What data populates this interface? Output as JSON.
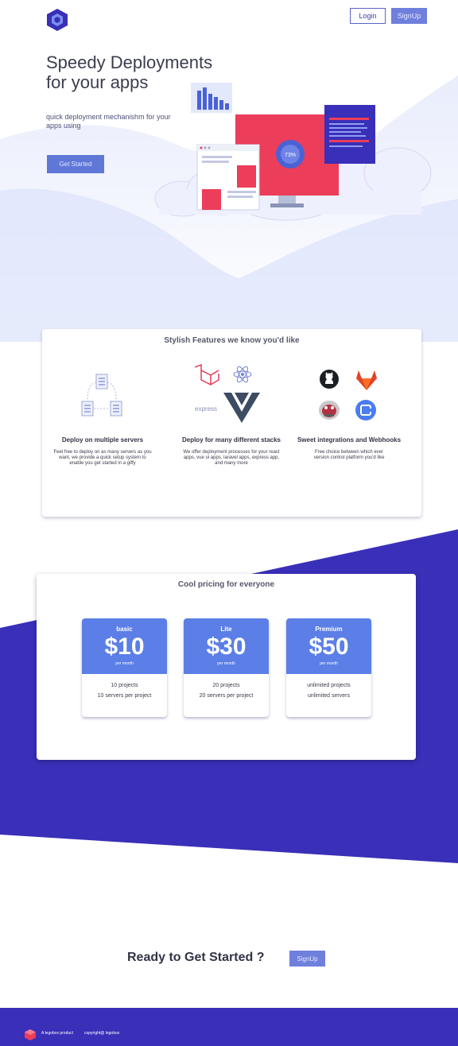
{
  "header": {
    "login_label": "Login",
    "signup_label": "SignUp"
  },
  "hero": {
    "title_line1": "Speedy Deployments",
    "title_line2": "for your apps",
    "subtitle": "quick deployment mechanishm for your apps using",
    "cta_label": "Get Started",
    "chart_percent": "73%"
  },
  "features": {
    "title": "Stylish Features we know you'd like",
    "items": [
      {
        "heading": "Deploy on multiple servers",
        "text": "Feel free to deploy on as many servers as you want, we provide a quick setup system to enable you get started in a giffy"
      },
      {
        "heading": "Deploy for many different stacks",
        "text": "We offer deployment processes for your react apps, vue ui apps, laravel apps, express app, and many more",
        "express_label": "express"
      },
      {
        "heading": "Sweet integrations and Webhooks",
        "text": "Free choice between which ever version control platform you'd like"
      }
    ]
  },
  "pricing": {
    "title": "Cool pricing for everyone",
    "plans": [
      {
        "name": "basic",
        "price": "$10",
        "per": "per month",
        "projects": "10 projects",
        "servers": "10 servers per project"
      },
      {
        "name": "Lite",
        "price": "$30",
        "per": "per month",
        "projects": "20 projects",
        "servers": "20 servers per project"
      },
      {
        "name": "Premium",
        "price": "$50",
        "per": "per month",
        "projects": "unlimited projects",
        "servers": "unlimited servers"
      }
    ]
  },
  "cta": {
    "text": "Ready to Get Started ?",
    "button_label": "SignUp"
  },
  "footer": {
    "product": "A legobox product",
    "copyright": "copyright@ legobox"
  },
  "colors": {
    "brand": "#3a2fb8",
    "accent": "#5b7fe6",
    "hero_bg": "#dfe6fb",
    "screen_red": "#ec3d5a"
  }
}
